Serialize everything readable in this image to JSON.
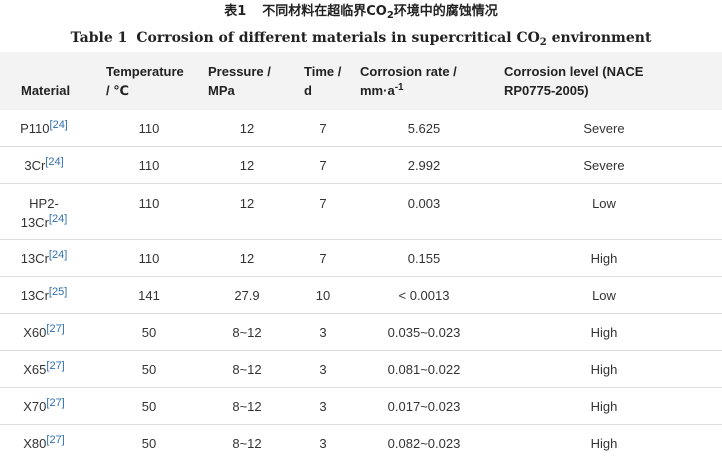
{
  "caption": {
    "zh_prefix": "表1",
    "zh_title_a": "不同材料在超临界CO",
    "zh_title_sub": "2",
    "zh_title_b": "环境中的腐蚀情况",
    "en_prefix": "Table 1",
    "en_title_a": "Corrosion of different materials in supercritical CO",
    "en_title_sub": "2",
    "en_title_b": " environment"
  },
  "columns": {
    "material": "Material",
    "temperature_l1": "Temperature",
    "temperature_l2": "/ ℃",
    "pressure_l1": "Pressure /",
    "pressure_l2": "MPa",
    "time_l1": "Time /",
    "time_l2": "d",
    "rate_l1": "Corrosion rate /",
    "rate_l2": "mm·a",
    "rate_sup": "-1",
    "level_l1": "Corrosion level (NACE",
    "level_l2": "RP0775-2005)"
  },
  "rows": [
    {
      "material": "P110",
      "ref": "[24]",
      "temperature": "110",
      "pressure": "12",
      "time": "7",
      "rate": "5.625",
      "level": "Severe"
    },
    {
      "material": "3Cr",
      "ref": "[24]",
      "temperature": "110",
      "pressure": "12",
      "time": "7",
      "rate": "2.992",
      "level": "Severe"
    },
    {
      "material_l1": "HP2-",
      "material": "13Cr",
      "ref": "[24]",
      "temperature": "110",
      "pressure": "12",
      "time": "7",
      "rate": "0.003",
      "level": "Low"
    },
    {
      "material": "13Cr",
      "ref": "[24]",
      "temperature": "110",
      "pressure": "12",
      "time": "7",
      "rate": "0.155",
      "level": "High"
    },
    {
      "material": "13Cr",
      "ref": "[25]",
      "temperature": "141",
      "pressure": "27.9",
      "time": "10",
      "rate": "< 0.0013",
      "level": "Low"
    },
    {
      "material": "X60",
      "ref": "[27]",
      "temperature": "50",
      "pressure": "8~12",
      "time": "3",
      "rate": "0.035~0.023",
      "level": "High"
    },
    {
      "material": "X65",
      "ref": "[27]",
      "temperature": "50",
      "pressure": "8~12",
      "time": "3",
      "rate": "0.081~0.022",
      "level": "High"
    },
    {
      "material": "X70",
      "ref": "[27]",
      "temperature": "50",
      "pressure": "8~12",
      "time": "3",
      "rate": "0.017~0.023",
      "level": "High"
    },
    {
      "material": "X80",
      "ref": "[27]",
      "temperature": "50",
      "pressure": "8~12",
      "time": "3",
      "rate": "0.082~0.023",
      "level": "High"
    }
  ]
}
